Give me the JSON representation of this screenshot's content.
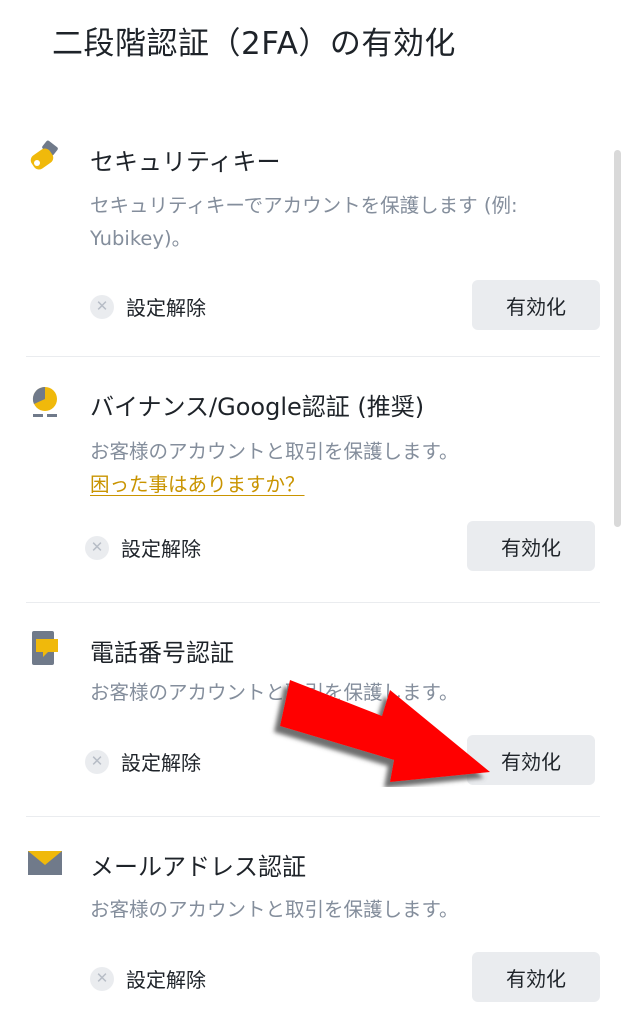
{
  "page": {
    "title": "二段階認証（2FA）の有効化"
  },
  "methods": [
    {
      "name": "セキュリティキー",
      "icon": "security-key-icon",
      "description_line1": "セキュリティキーでアカウントを保護します (例:",
      "description_line2": "Yubikey)。",
      "status": "設定解除",
      "button": "有効化"
    },
    {
      "name": "バイナンス/Google認証 (推奨)",
      "icon": "authenticator-icon",
      "description_line1": "お客様のアカウントと取引を保護します。",
      "help_link": "困った事はありますか？",
      "status": "設定解除",
      "button": "有効化"
    },
    {
      "name": "電話番号認証",
      "icon": "phone-icon",
      "description_line1": "お客様のアカウントと取引を保護します。",
      "status": "設定解除",
      "button": "有効化"
    },
    {
      "name": "メールアドレス認証",
      "icon": "email-icon",
      "description_line1": "お客様のアカウントと取引を保護します。",
      "status": "設定解除",
      "button": "有効化"
    }
  ],
  "colors": {
    "accent_yellow": "#f0b90b",
    "link_gold": "#c99400",
    "button_bg": "#eaecef",
    "muted_text": "#848e9c",
    "annotation_arrow": "#ff0000"
  }
}
